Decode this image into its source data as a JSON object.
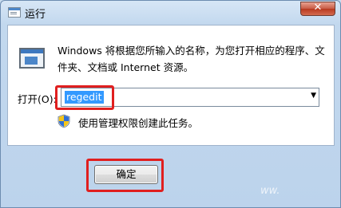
{
  "window": {
    "title": "运行",
    "close_label": "✕"
  },
  "main": {
    "description": "Windows 将根据您所输入的名称，为您打开相应的程序、文件夹、文档或 Internet 资源。",
    "open_label": "打开(O):",
    "command_value": "regedit",
    "admin_note": "使用管理权限创建此任务。",
    "ok_label": "确定"
  },
  "watermark": "ww.",
  "colors": {
    "highlight": "#e01f1f",
    "selection": "#3399ff"
  }
}
